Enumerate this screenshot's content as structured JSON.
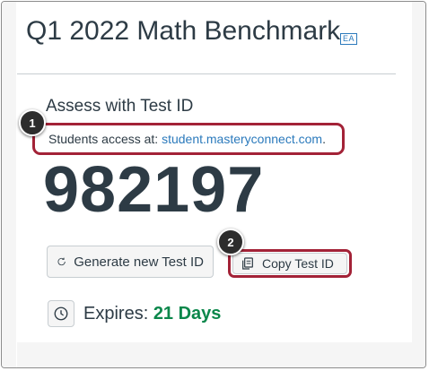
{
  "page": {
    "title": "Q1 2022 Math Benchmark",
    "badge": "EA"
  },
  "assess": {
    "section_title": "Assess with Test ID",
    "access_prefix": "Students access at: ",
    "access_link": "student.masteryconnect.com",
    "access_suffix": ".",
    "test_id": "982197"
  },
  "buttons": {
    "generate_label": "Generate new Test ID",
    "generate_icon": "refresh-icon",
    "copy_label": "Copy Test ID",
    "copy_icon": "copy-icon"
  },
  "expiry": {
    "icon": "clock-icon",
    "label": "Expires: ",
    "value": "21 Days"
  },
  "callouts": {
    "one": "1",
    "two": "2"
  },
  "colors": {
    "text": "#2d3b45",
    "link": "#2b7abc",
    "highlight": "#a32237",
    "expires": "#0b874b"
  }
}
